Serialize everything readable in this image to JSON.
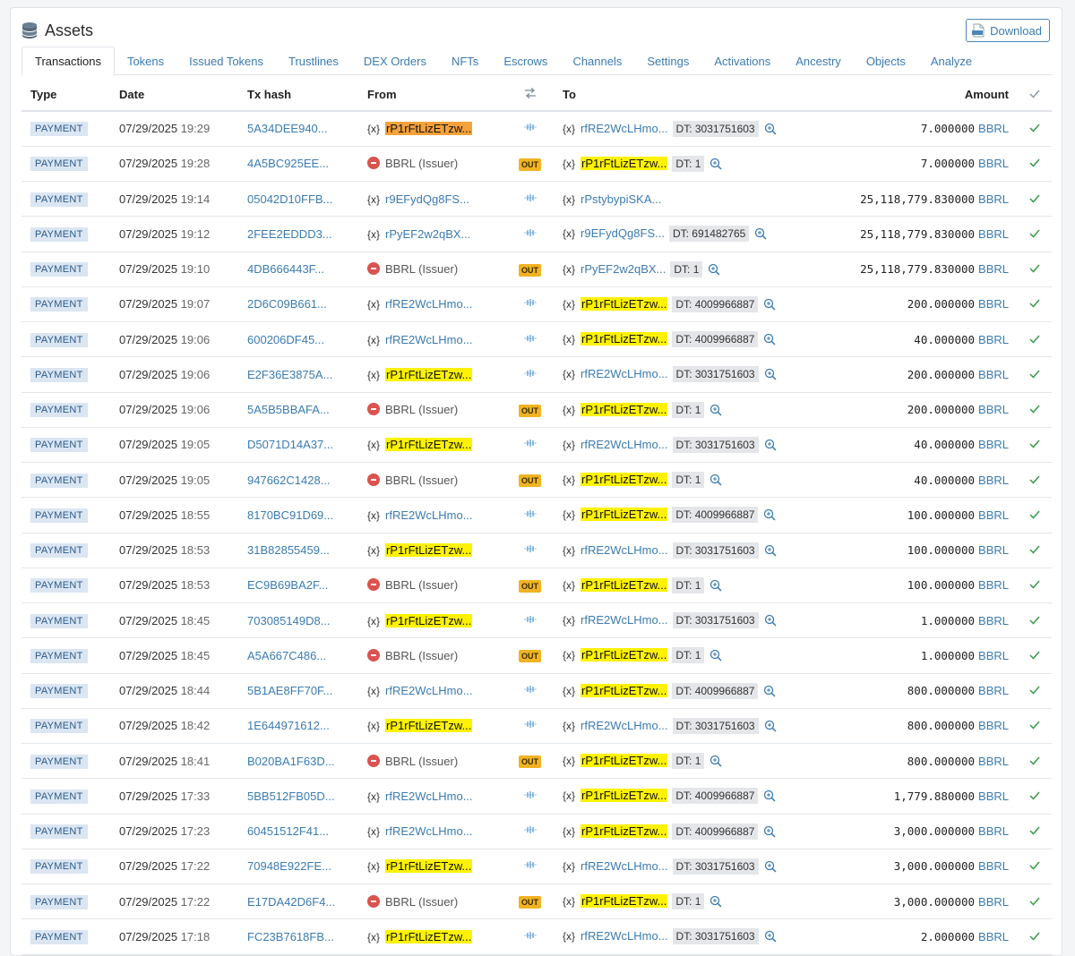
{
  "header": {
    "title": "Assets",
    "download_label": "Download"
  },
  "tabs": [
    "Transactions",
    "Tokens",
    "Issued Tokens",
    "Trustlines",
    "DEX Orders",
    "NFTs",
    "Escrows",
    "Channels",
    "Settings",
    "Activations",
    "Ancestry",
    "Objects",
    "Analyze"
  ],
  "active_tab": "Transactions",
  "columns": {
    "type": "Type",
    "date": "Date",
    "hash": "Tx hash",
    "from": "From",
    "to": "To",
    "amount": "Amount"
  },
  "rows": [
    {
      "type": "PAYMENT",
      "date": "07/29/2025",
      "time": "19:29",
      "hash": "5A34DEE940...",
      "from": "rP1rFtLizETzw...",
      "from_kind": "self-orange",
      "dir": "swap",
      "to": "rfRE2WcLHmo...",
      "to_kind": "addr",
      "dt": "DT: 3031751603",
      "amount": "7.000000",
      "currency": "BBRL"
    },
    {
      "type": "PAYMENT",
      "date": "07/29/2025",
      "time": "19:28",
      "hash": "4A5BC925EE...",
      "from": "BBRL (Issuer)",
      "from_kind": "issuer",
      "dir": "OUT",
      "to": "rP1rFtLizETzw...",
      "to_kind": "self",
      "dt": "DT: 1",
      "amount": "7.000000",
      "currency": "BBRL"
    },
    {
      "type": "PAYMENT",
      "date": "07/29/2025",
      "time": "19:14",
      "hash": "05042D10FFB...",
      "from": "r9EFydQg8FS...",
      "from_kind": "addr",
      "dir": "swap",
      "to": "rPstybypiSKA...",
      "to_kind": "addr",
      "dt": "",
      "amount": "25,118,779.830000",
      "currency": "BBRL"
    },
    {
      "type": "PAYMENT",
      "date": "07/29/2025",
      "time": "19:12",
      "hash": "2FEE2EDDD3...",
      "from": "rPyEF2w2qBX...",
      "from_kind": "addr",
      "dir": "swap",
      "to": "r9EFydQg8FS...",
      "to_kind": "addr",
      "dt": "DT: 691482765",
      "amount": "25,118,779.830000",
      "currency": "BBRL"
    },
    {
      "type": "PAYMENT",
      "date": "07/29/2025",
      "time": "19:10",
      "hash": "4DB666443F...",
      "from": "BBRL (Issuer)",
      "from_kind": "issuer",
      "dir": "OUT",
      "to": "rPyEF2w2qBX...",
      "to_kind": "addr",
      "dt": "DT: 1",
      "amount": "25,118,779.830000",
      "currency": "BBRL"
    },
    {
      "type": "PAYMENT",
      "date": "07/29/2025",
      "time": "19:07",
      "hash": "2D6C09B661...",
      "from": "rfRE2WcLHmo...",
      "from_kind": "addr",
      "dir": "swap",
      "to": "rP1rFtLizETzw...",
      "to_kind": "self",
      "dt": "DT: 4009966887",
      "amount": "200.000000",
      "currency": "BBRL"
    },
    {
      "type": "PAYMENT",
      "date": "07/29/2025",
      "time": "19:06",
      "hash": "600206DF45...",
      "from": "rfRE2WcLHmo...",
      "from_kind": "addr",
      "dir": "swap",
      "to": "rP1rFtLizETzw...",
      "to_kind": "self",
      "dt": "DT: 4009966887",
      "amount": "40.000000",
      "currency": "BBRL"
    },
    {
      "type": "PAYMENT",
      "date": "07/29/2025",
      "time": "19:06",
      "hash": "E2F36E3875A...",
      "from": "rP1rFtLizETzw...",
      "from_kind": "self",
      "dir": "swap",
      "to": "rfRE2WcLHmo...",
      "to_kind": "addr",
      "dt": "DT: 3031751603",
      "amount": "200.000000",
      "currency": "BBRL"
    },
    {
      "type": "PAYMENT",
      "date": "07/29/2025",
      "time": "19:06",
      "hash": "5A5B5BBAFA...",
      "from": "BBRL (Issuer)",
      "from_kind": "issuer",
      "dir": "OUT",
      "to": "rP1rFtLizETzw...",
      "to_kind": "self",
      "dt": "DT: 1",
      "amount": "200.000000",
      "currency": "BBRL"
    },
    {
      "type": "PAYMENT",
      "date": "07/29/2025",
      "time": "19:05",
      "hash": "D5071D14A37...",
      "from": "rP1rFtLizETzw...",
      "from_kind": "self",
      "dir": "swap",
      "to": "rfRE2WcLHmo...",
      "to_kind": "addr",
      "dt": "DT: 3031751603",
      "amount": "40.000000",
      "currency": "BBRL"
    },
    {
      "type": "PAYMENT",
      "date": "07/29/2025",
      "time": "19:05",
      "hash": "947662C1428...",
      "from": "BBRL (Issuer)",
      "from_kind": "issuer",
      "dir": "OUT",
      "to": "rP1rFtLizETzw...",
      "to_kind": "self",
      "dt": "DT: 1",
      "amount": "40.000000",
      "currency": "BBRL"
    },
    {
      "type": "PAYMENT",
      "date": "07/29/2025",
      "time": "18:55",
      "hash": "8170BC91D69...",
      "from": "rfRE2WcLHmo...",
      "from_kind": "addr",
      "dir": "swap",
      "to": "rP1rFtLizETzw...",
      "to_kind": "self",
      "dt": "DT: 4009966887",
      "amount": "100.000000",
      "currency": "BBRL"
    },
    {
      "type": "PAYMENT",
      "date": "07/29/2025",
      "time": "18:53",
      "hash": "31B82855459...",
      "from": "rP1rFtLizETzw...",
      "from_kind": "self",
      "dir": "swap",
      "to": "rfRE2WcLHmo...",
      "to_kind": "addr",
      "dt": "DT: 3031751603",
      "amount": "100.000000",
      "currency": "BBRL"
    },
    {
      "type": "PAYMENT",
      "date": "07/29/2025",
      "time": "18:53",
      "hash": "EC9B69BA2F...",
      "from": "BBRL (Issuer)",
      "from_kind": "issuer",
      "dir": "OUT",
      "to": "rP1rFtLizETzw...",
      "to_kind": "self",
      "dt": "DT: 1",
      "amount": "100.000000",
      "currency": "BBRL"
    },
    {
      "type": "PAYMENT",
      "date": "07/29/2025",
      "time": "18:45",
      "hash": "703085149D8...",
      "from": "rP1rFtLizETzw...",
      "from_kind": "self",
      "dir": "swap",
      "to": "rfRE2WcLHmo...",
      "to_kind": "addr",
      "dt": "DT: 3031751603",
      "amount": "1.000000",
      "currency": "BBRL"
    },
    {
      "type": "PAYMENT",
      "date": "07/29/2025",
      "time": "18:45",
      "hash": "A5A667C486...",
      "from": "BBRL (Issuer)",
      "from_kind": "issuer",
      "dir": "OUT",
      "to": "rP1rFtLizETzw...",
      "to_kind": "self",
      "dt": "DT: 1",
      "amount": "1.000000",
      "currency": "BBRL"
    },
    {
      "type": "PAYMENT",
      "date": "07/29/2025",
      "time": "18:44",
      "hash": "5B1AE8FF70F...",
      "from": "rfRE2WcLHmo...",
      "from_kind": "addr",
      "dir": "swap",
      "to": "rP1rFtLizETzw...",
      "to_kind": "self",
      "dt": "DT: 4009966887",
      "amount": "800.000000",
      "currency": "BBRL"
    },
    {
      "type": "PAYMENT",
      "date": "07/29/2025",
      "time": "18:42",
      "hash": "1E644971612...",
      "from": "rP1rFtLizETzw...",
      "from_kind": "self",
      "dir": "swap",
      "to": "rfRE2WcLHmo...",
      "to_kind": "addr",
      "dt": "DT: 3031751603",
      "amount": "800.000000",
      "currency": "BBRL"
    },
    {
      "type": "PAYMENT",
      "date": "07/29/2025",
      "time": "18:41",
      "hash": "B020BA1F63D...",
      "from": "BBRL (Issuer)",
      "from_kind": "issuer",
      "dir": "OUT",
      "to": "rP1rFtLizETzw...",
      "to_kind": "self",
      "dt": "DT: 1",
      "amount": "800.000000",
      "currency": "BBRL"
    },
    {
      "type": "PAYMENT",
      "date": "07/29/2025",
      "time": "17:33",
      "hash": "5BB512FB05D...",
      "from": "rfRE2WcLHmo...",
      "from_kind": "addr",
      "dir": "swap",
      "to": "rP1rFtLizETzw...",
      "to_kind": "self",
      "dt": "DT: 4009966887",
      "amount": "1,779.880000",
      "currency": "BBRL"
    },
    {
      "type": "PAYMENT",
      "date": "07/29/2025",
      "time": "17:23",
      "hash": "60451512F41...",
      "from": "rfRE2WcLHmo...",
      "from_kind": "addr",
      "dir": "swap",
      "to": "rP1rFtLizETzw...",
      "to_kind": "self",
      "dt": "DT: 4009966887",
      "amount": "3,000.000000",
      "currency": "BBRL"
    },
    {
      "type": "PAYMENT",
      "date": "07/29/2025",
      "time": "17:22",
      "hash": "70948E922FE...",
      "from": "rP1rFtLizETzw...",
      "from_kind": "self",
      "dir": "swap",
      "to": "rfRE2WcLHmo...",
      "to_kind": "addr",
      "dt": "DT: 3031751603",
      "amount": "3,000.000000",
      "currency": "BBRL"
    },
    {
      "type": "PAYMENT",
      "date": "07/29/2025",
      "time": "17:22",
      "hash": "E17DA42D6F4...",
      "from": "BBRL (Issuer)",
      "from_kind": "issuer",
      "dir": "OUT",
      "to": "rP1rFtLizETzw...",
      "to_kind": "self",
      "dt": "DT: 1",
      "amount": "3,000.000000",
      "currency": "BBRL"
    },
    {
      "type": "PAYMENT",
      "date": "07/29/2025",
      "time": "17:18",
      "hash": "FC23B7618FB...",
      "from": "rP1rFtLizETzw...",
      "from_kind": "self",
      "dir": "swap",
      "to": "rfRE2WcLHmo...",
      "to_kind": "addr",
      "dt": "DT: 3031751603",
      "amount": "2.000000",
      "currency": "BBRL"
    }
  ],
  "icons": {
    "var": "{x}",
    "swap": "swap-arrows-icon",
    "check": "check-icon",
    "zoom": "magnifier-icon",
    "issuer": "issuer-icon"
  }
}
